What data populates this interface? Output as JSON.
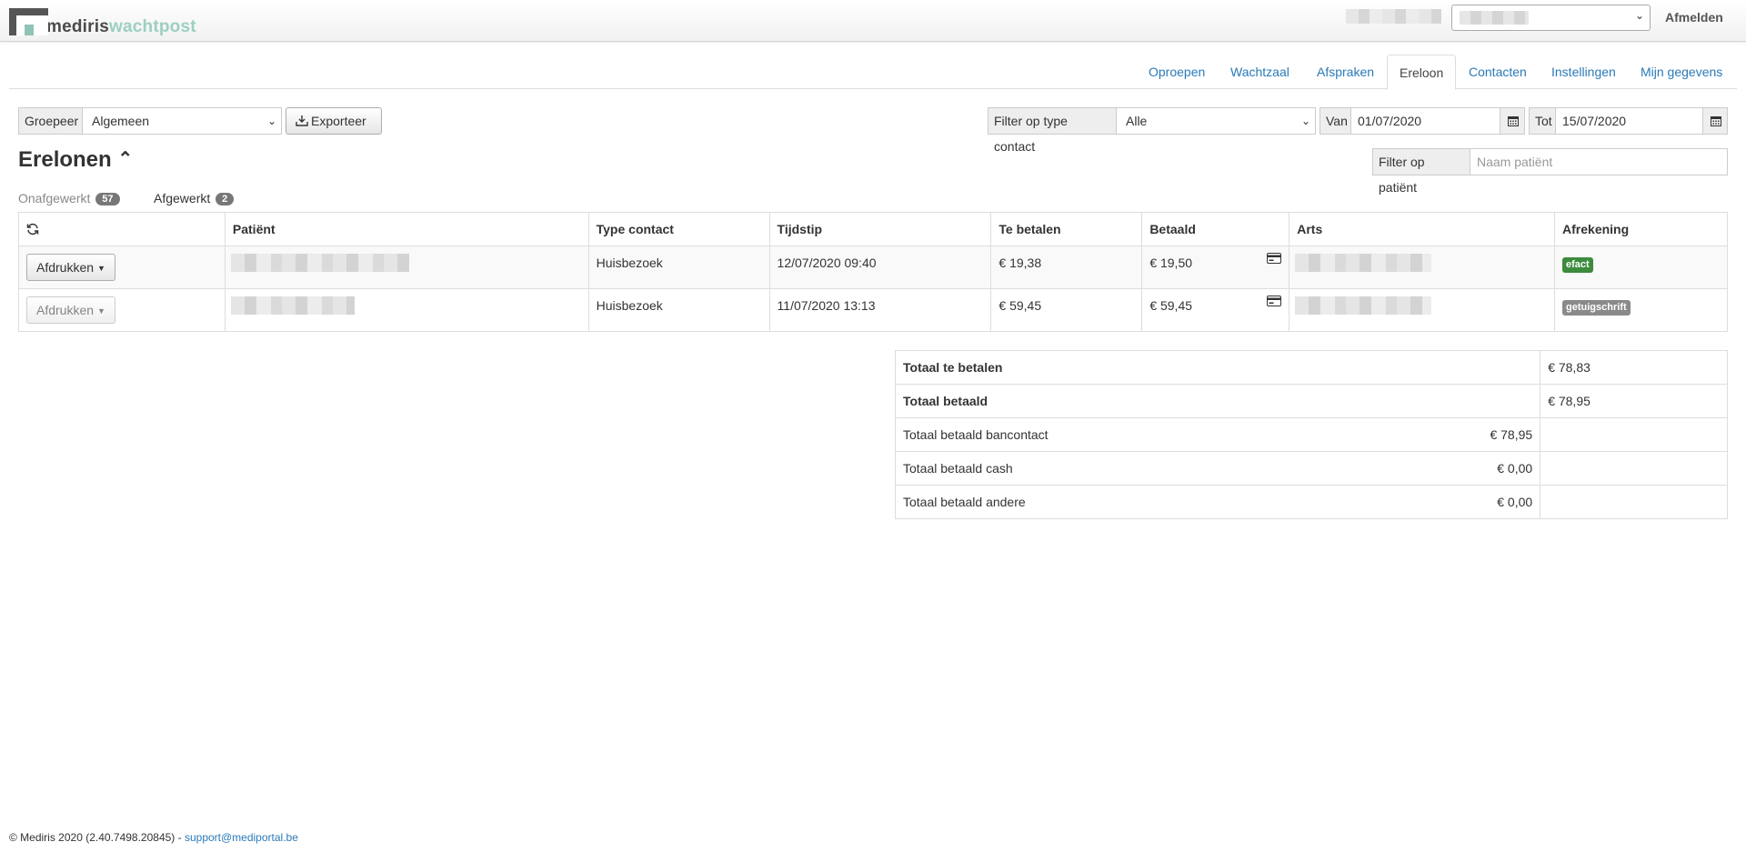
{
  "header": {
    "logo_part1": "mediris",
    "logo_part2": "wachtpost",
    "logout_label": "Afmelden"
  },
  "tabs": [
    {
      "label": "Oproepen"
    },
    {
      "label": "Wachtzaal"
    },
    {
      "label": "Afspraken"
    },
    {
      "label": "Ereloon",
      "active": true
    },
    {
      "label": "Contacten"
    },
    {
      "label": "Instellingen"
    },
    {
      "label": "Mijn gegevens"
    }
  ],
  "controls": {
    "group_label": "Groepeer",
    "group_value": "Algemeen",
    "export_label": "Exporteer",
    "contact_filter_label": "Filter op type contact",
    "contact_filter_value": "Alle",
    "from_label": "Van",
    "from_value": "01/07/2020",
    "to_label": "Tot",
    "to_value": "15/07/2020",
    "patient_filter_label": "Filter op patiënt",
    "patient_filter_placeholder": "Naam patiënt"
  },
  "title": "Erelonen",
  "title_toggle": "⌃",
  "subtabs": {
    "open_label": "Onafgewerkt",
    "open_count": "57",
    "done_label": "Afgewerkt",
    "done_count": "2"
  },
  "table": {
    "headers": {
      "patient": "Patiënt",
      "type": "Type contact",
      "time": "Tijdstip",
      "due": "Te betalen",
      "paid": "Betaald",
      "doctor": "Arts",
      "settlement": "Afrekening"
    },
    "print_label": "Afdrukken",
    "rows": [
      {
        "type": "Huisbezoek",
        "time": "12/07/2020 09:40",
        "due": "€ 19,38",
        "paid": "€ 19,50",
        "settlement": "efact"
      },
      {
        "type": "Huisbezoek",
        "time": "11/07/2020 13:13",
        "due": "€ 59,45",
        "paid": "€ 59,45",
        "settlement": "getuigschrift"
      }
    ]
  },
  "totals": {
    "due_label": "Totaal te betalen",
    "due_value": "€ 78,83",
    "paid_label": "Totaal betaald",
    "paid_value": "€ 78,95",
    "bancontact_label": "Totaal betaald bancontact",
    "bancontact_value": "€ 78,95",
    "cash_label": "Totaal betaald cash",
    "cash_value": "€ 0,00",
    "other_label": "Totaal betaald andere",
    "other_value": "€ 0,00"
  },
  "footer": {
    "text": "© Mediris 2020 (2.40.7498.20845) - ",
    "link": "support@mediportal.be"
  },
  "colors": {
    "link": "#2a7ab8",
    "efact": "#3d8b3d",
    "getuigschrift": "#8a8a8a",
    "badge": "#777777"
  }
}
